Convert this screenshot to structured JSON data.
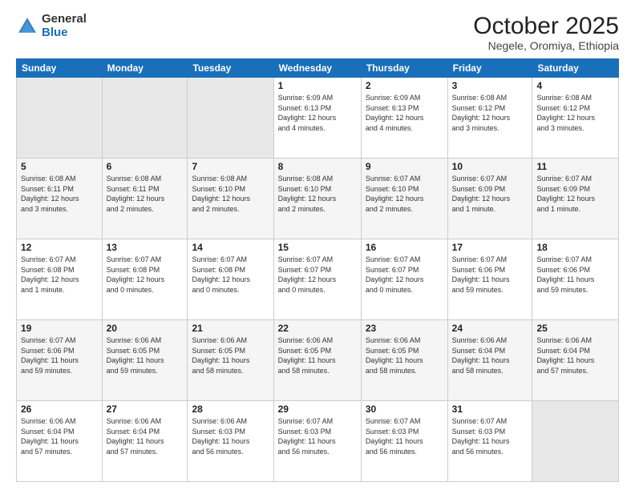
{
  "logo": {
    "general": "General",
    "blue": "Blue"
  },
  "header": {
    "month": "October 2025",
    "location": "Negele, Oromiya, Ethiopia"
  },
  "weekdays": [
    "Sunday",
    "Monday",
    "Tuesday",
    "Wednesday",
    "Thursday",
    "Friday",
    "Saturday"
  ],
  "weeks": [
    [
      {
        "day": "",
        "info": ""
      },
      {
        "day": "",
        "info": ""
      },
      {
        "day": "",
        "info": ""
      },
      {
        "day": "1",
        "info": "Sunrise: 6:09 AM\nSunset: 6:13 PM\nDaylight: 12 hours\nand 4 minutes."
      },
      {
        "day": "2",
        "info": "Sunrise: 6:09 AM\nSunset: 6:13 PM\nDaylight: 12 hours\nand 4 minutes."
      },
      {
        "day": "3",
        "info": "Sunrise: 6:08 AM\nSunset: 6:12 PM\nDaylight: 12 hours\nand 3 minutes."
      },
      {
        "day": "4",
        "info": "Sunrise: 6:08 AM\nSunset: 6:12 PM\nDaylight: 12 hours\nand 3 minutes."
      }
    ],
    [
      {
        "day": "5",
        "info": "Sunrise: 6:08 AM\nSunset: 6:11 PM\nDaylight: 12 hours\nand 3 minutes."
      },
      {
        "day": "6",
        "info": "Sunrise: 6:08 AM\nSunset: 6:11 PM\nDaylight: 12 hours\nand 2 minutes."
      },
      {
        "day": "7",
        "info": "Sunrise: 6:08 AM\nSunset: 6:10 PM\nDaylight: 12 hours\nand 2 minutes."
      },
      {
        "day": "8",
        "info": "Sunrise: 6:08 AM\nSunset: 6:10 PM\nDaylight: 12 hours\nand 2 minutes."
      },
      {
        "day": "9",
        "info": "Sunrise: 6:07 AM\nSunset: 6:10 PM\nDaylight: 12 hours\nand 2 minutes."
      },
      {
        "day": "10",
        "info": "Sunrise: 6:07 AM\nSunset: 6:09 PM\nDaylight: 12 hours\nand 1 minute."
      },
      {
        "day": "11",
        "info": "Sunrise: 6:07 AM\nSunset: 6:09 PM\nDaylight: 12 hours\nand 1 minute."
      }
    ],
    [
      {
        "day": "12",
        "info": "Sunrise: 6:07 AM\nSunset: 6:08 PM\nDaylight: 12 hours\nand 1 minute."
      },
      {
        "day": "13",
        "info": "Sunrise: 6:07 AM\nSunset: 6:08 PM\nDaylight: 12 hours\nand 0 minutes."
      },
      {
        "day": "14",
        "info": "Sunrise: 6:07 AM\nSunset: 6:08 PM\nDaylight: 12 hours\nand 0 minutes."
      },
      {
        "day": "15",
        "info": "Sunrise: 6:07 AM\nSunset: 6:07 PM\nDaylight: 12 hours\nand 0 minutes."
      },
      {
        "day": "16",
        "info": "Sunrise: 6:07 AM\nSunset: 6:07 PM\nDaylight: 12 hours\nand 0 minutes."
      },
      {
        "day": "17",
        "info": "Sunrise: 6:07 AM\nSunset: 6:06 PM\nDaylight: 11 hours\nand 59 minutes."
      },
      {
        "day": "18",
        "info": "Sunrise: 6:07 AM\nSunset: 6:06 PM\nDaylight: 11 hours\nand 59 minutes."
      }
    ],
    [
      {
        "day": "19",
        "info": "Sunrise: 6:07 AM\nSunset: 6:06 PM\nDaylight: 11 hours\nand 59 minutes."
      },
      {
        "day": "20",
        "info": "Sunrise: 6:06 AM\nSunset: 6:05 PM\nDaylight: 11 hours\nand 59 minutes."
      },
      {
        "day": "21",
        "info": "Sunrise: 6:06 AM\nSunset: 6:05 PM\nDaylight: 11 hours\nand 58 minutes."
      },
      {
        "day": "22",
        "info": "Sunrise: 6:06 AM\nSunset: 6:05 PM\nDaylight: 11 hours\nand 58 minutes."
      },
      {
        "day": "23",
        "info": "Sunrise: 6:06 AM\nSunset: 6:05 PM\nDaylight: 11 hours\nand 58 minutes."
      },
      {
        "day": "24",
        "info": "Sunrise: 6:06 AM\nSunset: 6:04 PM\nDaylight: 11 hours\nand 58 minutes."
      },
      {
        "day": "25",
        "info": "Sunrise: 6:06 AM\nSunset: 6:04 PM\nDaylight: 11 hours\nand 57 minutes."
      }
    ],
    [
      {
        "day": "26",
        "info": "Sunrise: 6:06 AM\nSunset: 6:04 PM\nDaylight: 11 hours\nand 57 minutes."
      },
      {
        "day": "27",
        "info": "Sunrise: 6:06 AM\nSunset: 6:04 PM\nDaylight: 11 hours\nand 57 minutes."
      },
      {
        "day": "28",
        "info": "Sunrise: 6:06 AM\nSunset: 6:03 PM\nDaylight: 11 hours\nand 56 minutes."
      },
      {
        "day": "29",
        "info": "Sunrise: 6:07 AM\nSunset: 6:03 PM\nDaylight: 11 hours\nand 56 minutes."
      },
      {
        "day": "30",
        "info": "Sunrise: 6:07 AM\nSunset: 6:03 PM\nDaylight: 11 hours\nand 56 minutes."
      },
      {
        "day": "31",
        "info": "Sunrise: 6:07 AM\nSunset: 6:03 PM\nDaylight: 11 hours\nand 56 minutes."
      },
      {
        "day": "",
        "info": ""
      }
    ]
  ]
}
